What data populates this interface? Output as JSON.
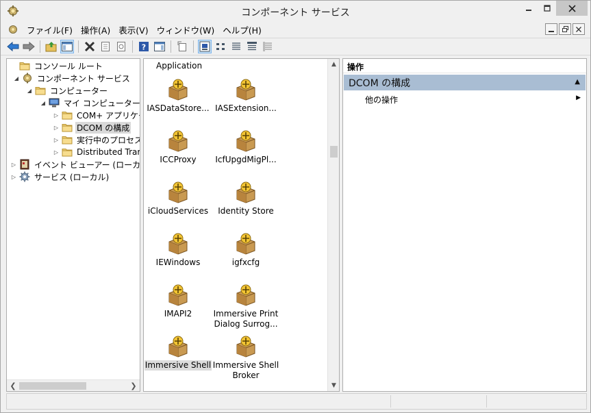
{
  "window": {
    "title": "コンポーネント サービス"
  },
  "menu": [
    "ファイル(F)",
    "操作(A)",
    "表示(V)",
    "ウィンドウ(W)",
    "ヘルプ(H)"
  ],
  "toolbar": {
    "buttons": [
      "back-icon",
      "forward-icon",
      "up-folder-icon",
      "show-hide-tree-icon",
      "delete-icon",
      "properties-icon",
      "refresh-icon",
      "help-icon",
      "show-hide-action-icon",
      "export-icon",
      "large-icons-view-icon",
      "small-icons-view-icon",
      "list-view-icon",
      "detail-view-icon",
      "status-view-icon"
    ],
    "active": "large-icons-view-icon"
  },
  "tree": {
    "items": [
      {
        "label": "コンソール ルート",
        "level": 0,
        "expander": "",
        "icon": "folder-icon"
      },
      {
        "label": "コンポーネント サービス",
        "level": 1,
        "expander": "◢",
        "icon": "component-services-icon"
      },
      {
        "label": "コンピューター",
        "level": 2,
        "expander": "◢",
        "icon": "folder-icon"
      },
      {
        "label": "マイ コンピューター",
        "level": 3,
        "expander": "◢",
        "icon": "computer-icon"
      },
      {
        "label": "COM+ アプリケーシ",
        "level": 4,
        "expander": "▷",
        "icon": "folder-icon"
      },
      {
        "label": "DCOM の構成",
        "level": 4,
        "expander": "▷",
        "icon": "folder-icon",
        "selected": true
      },
      {
        "label": "実行中のプロセス",
        "level": 4,
        "expander": "▷",
        "icon": "folder-icon"
      },
      {
        "label": "Distributed Trar",
        "level": 4,
        "expander": "▷",
        "icon": "folder-icon"
      },
      {
        "label": "イベント ビューアー (ローカル)",
        "level": 0,
        "expander": "▷",
        "icon": "event-viewer-icon"
      },
      {
        "label": "サービス (ローカル)",
        "level": 0,
        "expander": "▷",
        "icon": "services-gear-icon"
      }
    ]
  },
  "list": {
    "header": "Application",
    "items": [
      {
        "label": "IASDataStore...",
        "col": 0,
        "row": 0
      },
      {
        "label": "IASExtension...",
        "col": 1,
        "row": 0
      },
      {
        "label": "ICCProxy",
        "col": 0,
        "row": 1
      },
      {
        "label": "IcfUpgdMigPl...",
        "col": 1,
        "row": 1
      },
      {
        "label": "iCloudServices",
        "col": 0,
        "row": 2
      },
      {
        "label": "Identity Store",
        "col": 1,
        "row": 2
      },
      {
        "label": "IEWindows",
        "col": 0,
        "row": 3
      },
      {
        "label": "igfxcfg",
        "col": 1,
        "row": 3
      },
      {
        "label": "IMAPI2",
        "col": 0,
        "row": 4
      },
      {
        "label": "Immersive Print\nDialog Surrog...",
        "col": 1,
        "row": 4
      },
      {
        "label": "Immersive Shell",
        "col": 0,
        "row": 5,
        "selected": true
      },
      {
        "label": "Immersive Shell\nBroker",
        "col": 1,
        "row": 5
      }
    ]
  },
  "actions": {
    "header": "操作",
    "section": "DCOM の構成",
    "more": "他の操作"
  },
  "colors": {
    "section_bg": "#a9bdd3",
    "selection": "#d9d9d9",
    "active_tool": "#cbe4f7"
  }
}
